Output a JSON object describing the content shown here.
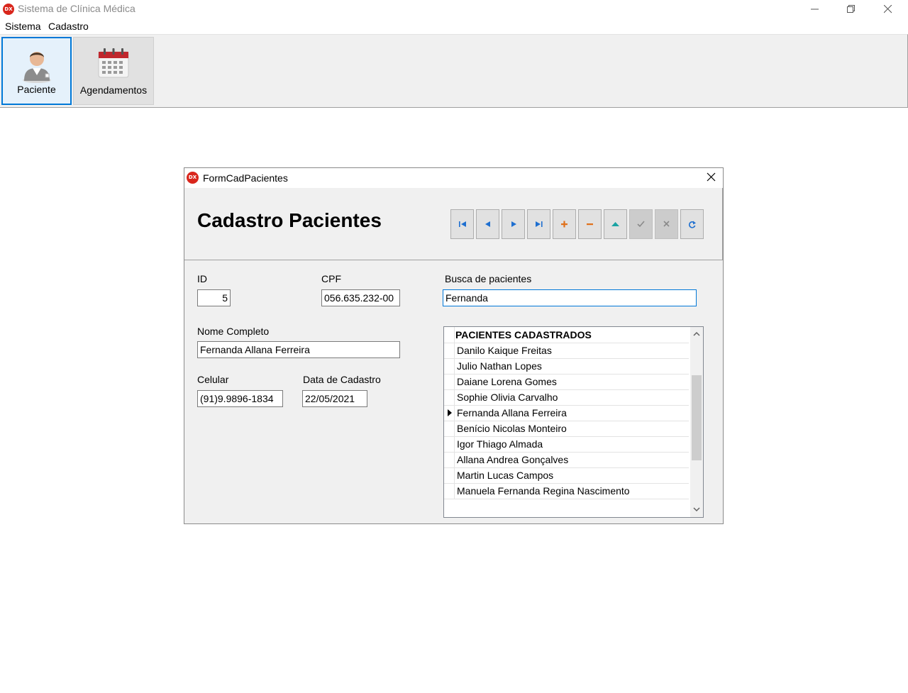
{
  "window": {
    "icon_text": "DX",
    "title": "Sistema de Clínica Médica"
  },
  "menu": {
    "items": [
      "Sistema",
      "Cadastro"
    ]
  },
  "toolbar": {
    "buttons": [
      {
        "label": "Paciente",
        "icon": "patient-icon",
        "active": true
      },
      {
        "label": "Agendamentos",
        "icon": "calendar-icon",
        "active": false
      }
    ]
  },
  "form": {
    "icon_text": "DX",
    "title": "FormCadPacientes",
    "heading": "Cadastro Pacientes",
    "navigator": [
      {
        "name": "first-record",
        "icon": "first-icon",
        "enabled": true
      },
      {
        "name": "prior-record",
        "icon": "prior-icon",
        "enabled": true
      },
      {
        "name": "next-record",
        "icon": "next-icon",
        "enabled": true
      },
      {
        "name": "last-record",
        "icon": "last-icon",
        "enabled": true
      },
      {
        "name": "insert-record",
        "icon": "plus-icon",
        "enabled": true
      },
      {
        "name": "delete-record",
        "icon": "minus-icon",
        "enabled": true
      },
      {
        "name": "edit-record",
        "icon": "edit-up-icon",
        "enabled": true
      },
      {
        "name": "post-record",
        "icon": "check-icon",
        "enabled": false
      },
      {
        "name": "cancel-record",
        "icon": "x-icon",
        "enabled": false
      },
      {
        "name": "refresh-record",
        "icon": "refresh-icon",
        "enabled": true
      }
    ],
    "fields": {
      "id": {
        "label": "ID",
        "value": "5"
      },
      "cpf": {
        "label": "CPF",
        "value": "056.635.232-00"
      },
      "search": {
        "label": "Busca de pacientes",
        "value": "Fernanda"
      },
      "nome": {
        "label": "Nome Completo",
        "value": "Fernanda Allana Ferreira"
      },
      "celular": {
        "label": "Celular",
        "value": "(91)9.9896-1834"
      },
      "data_cadastro": {
        "label": "Data de Cadastro",
        "value": "22/05/2021"
      }
    },
    "grid": {
      "header": "PACIENTES CADASTRADOS",
      "rows": [
        "Danilo Kaique Freitas",
        "Julio Nathan Lopes",
        "Daiane Lorena Gomes",
        "Sophie Olivia Carvalho",
        "Fernanda Allana Ferreira",
        "Benício Nicolas Monteiro",
        "Igor Thiago Almada",
        "Allana Andrea Gonçalves",
        "Martin Lucas Campos",
        "Manuela Fernanda Regina Nascimento"
      ],
      "selected_row": "Fernanda Allana Ferreira"
    }
  },
  "colors": {
    "accent": "#0078d7",
    "brand_icon": "#d9261c",
    "nav_blue": "#1e6fd0",
    "nav_add": "#e0701a",
    "nav_edit": "#1aa3a3"
  }
}
